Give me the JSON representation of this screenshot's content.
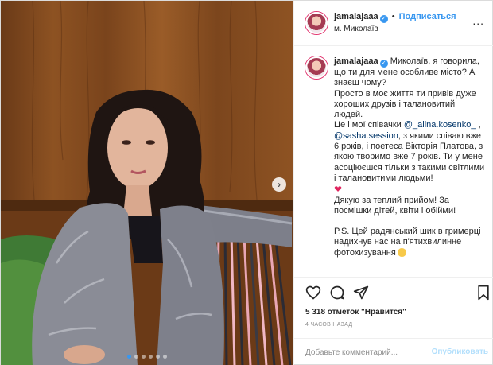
{
  "header": {
    "username": "jamalajaaa",
    "separator": "•",
    "follow_label": "Подписаться",
    "location": "м. Миколаїв",
    "more_label": "..."
  },
  "photo": {
    "next_label": "›",
    "carousel_total": 6,
    "carousel_active": 1
  },
  "caption": {
    "username": "jamalajaaa",
    "intro": "Миколаїв, я говорила, що ти для мене особливе місто? А знаєш чому?",
    "line2": "Просто в моє життя ти привів дуже хороших друзів і талановитий людей.",
    "line3_start": "Це і мої співачки ",
    "mention1": "@_alina.kosenko_",
    "line3_comma": " ,",
    "mention2": "@sasha.session",
    "line3_rest": ", з якими співаю вже 6 років, і поетеса Вікторія Платова, з якою творимо вже 7 років. Ти у мене асоціюєшся тільки з такими світлими і талановитими людьми!",
    "heart": "❤",
    "thanks": "Дякую за теплий прийом! За посмішки дітей, квіти і обійми!",
    "ps": "P.S. Цей радянський шик в гримерці надихнув нас на п'ятихвилинне фотохизування"
  },
  "actions": {
    "likes": "5 318 отметок \"Нравится\"",
    "time": "4 ЧАСОВ НАЗАД",
    "comment_placeholder": "Добавьте комментарий...",
    "publish_label": "Опубликовать"
  },
  "colors": {
    "accent": "#3897f0",
    "text": "#262626",
    "muted": "#8e8e8e",
    "publish_disabled": "#b2dffc"
  }
}
